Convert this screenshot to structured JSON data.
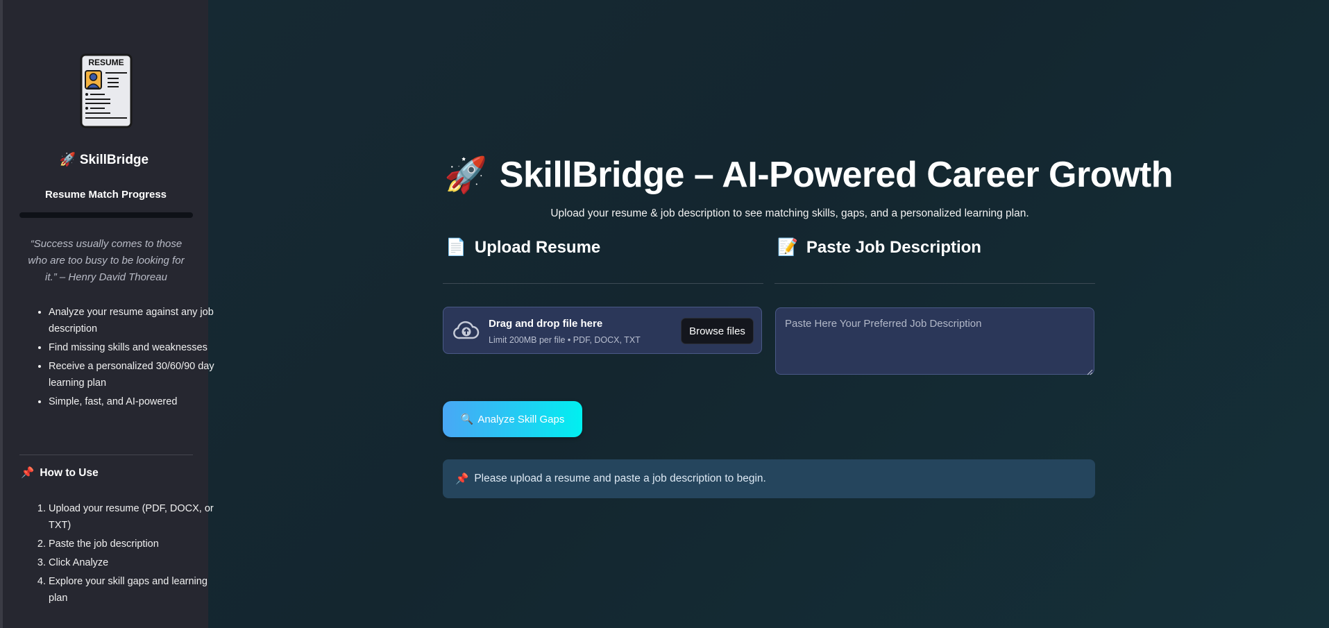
{
  "sidebar": {
    "logo_text": "RESUME",
    "brand": "SkillBridge",
    "progress_title": "Resume Match Progress",
    "progress_fraction": 0,
    "quote": "“Success usually comes to those who are too busy to be looking for it.” – Henry David Thoreau",
    "features": [
      "Analyze your resume against any job description",
      "Find missing skills and weaknesses",
      "Receive a personalized 30/60/90 day learning plan",
      "Simple, fast, and AI-powered"
    ],
    "howto_title": "How to Use",
    "steps": [
      "Upload your resume (PDF, DOCX, or TXT)",
      "Paste the job description",
      "Click Analyze",
      "Explore your skill gaps and learning plan"
    ]
  },
  "main": {
    "title": "SkillBridge – AI-Powered Career Growth",
    "subtitle": "Upload your resume & job description to see matching skills, gaps, and a personalized learning plan.",
    "upload_heading": "Upload Resume",
    "jd_heading": "Paste Job Description",
    "uploader": {
      "main_text": "Drag and drop file here",
      "limit_text": "Limit 200MB per file • PDF, DOCX, TXT",
      "browse_label": "Browse files"
    },
    "jd_placeholder": "Paste Here Your Preferred Job Description",
    "analyze_label": "Analyze Skill Gaps",
    "info_message": "Please upload a resume and paste a job description to begin."
  },
  "colors": {
    "sidebar_bg": "#262730",
    "main_bg": "#172a34",
    "input_bg": "#2b3759",
    "button_gradient_start": "#49a7f5",
    "button_gradient_end": "#00f0f0",
    "info_bg": "#25455d"
  }
}
